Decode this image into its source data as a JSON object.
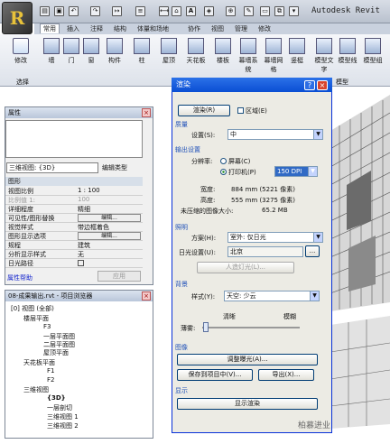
{
  "app": {
    "logo": "R",
    "title": "Autodesk Revit"
  },
  "ribbon": {
    "tabs": [
      "常用",
      "插入",
      "注释",
      "结构",
      "体量和场地",
      "协作",
      "视图",
      "管理",
      "修改"
    ],
    "buttons": [
      "墙",
      "门",
      "窗",
      "构件",
      "柱",
      "屋顶",
      "天花板",
      "楼板",
      "幕墙系统",
      "幕墙网格",
      "竖梃",
      "模型文字",
      "模型线",
      "模型组"
    ],
    "modify": "修改",
    "panel_select": "选择",
    "panel_model": "模型"
  },
  "properties": {
    "title": "属性",
    "type_value": "三维视图: {3D}",
    "edit_type": "编辑类型",
    "section": "图形",
    "rows": [
      {
        "key": "视图比例",
        "value": "1 : 100"
      },
      {
        "key": "比例值 1:",
        "value": "100"
      },
      {
        "key": "详细程度",
        "value": "精细"
      },
      {
        "key": "可见性/图形替换",
        "value": "编辑..."
      },
      {
        "key": "视觉样式",
        "value": "带边框着色"
      },
      {
        "key": "图形显示选项",
        "value": "编辑..."
      },
      {
        "key": "规程",
        "value": "建筑"
      },
      {
        "key": "分析显示样式",
        "value": "无"
      },
      {
        "key": "日光路径",
        "value": ""
      }
    ],
    "help": "属性帮助",
    "apply": "应用"
  },
  "browser": {
    "title": "08-成果输出.rvt - 项目浏览器",
    "nodes": [
      "[0] 视图 (全部)",
      "楼层平面",
      "F3",
      "一层平面图",
      "二层平面图",
      "屋顶平面",
      "天花板平面",
      "F1",
      "F2",
      "三维视图",
      "{3D}",
      "一层剖切",
      "三维视图 1",
      "三维视图 2"
    ]
  },
  "dialog": {
    "title": "渲染",
    "render_btn": "渲染(R)",
    "region": "区域(E)",
    "quality": {
      "label": "质量",
      "setting_label": "设置(S):",
      "value": "中"
    },
    "output": {
      "label": "输出设置",
      "resolution_label": "分辨率:",
      "screen": "屏幕(C)",
      "printer": "打印机(P)",
      "dpi": "150 DPI",
      "width_label": "宽度:",
      "width": "884 mm (5221 像素)",
      "height_label": "高度:",
      "height": "555 mm (3275 像素)",
      "size_label": "未压缩的图像大小:",
      "size": "65.2 MB"
    },
    "lighting": {
      "label": "照明",
      "scheme_label": "方案(H):",
      "scheme": "室外: 仅日光",
      "sun_label": "日光设置(U):",
      "sun": "北京",
      "artificial": "人造灯光(L)..."
    },
    "background": {
      "label": "背景",
      "style_label": "样式(Y):",
      "style": "天空: 少云",
      "clear": "清晰",
      "hazy": "模糊",
      "haze_label": "薄雾:",
      "haze_level": 0.02
    },
    "image": {
      "label": "图像",
      "adjust": "调整曝光(A)...",
      "save": "保存到项目中(V)...",
      "export": "导出(X)..."
    },
    "display": {
      "label": "显示",
      "show": "显示渲染"
    }
  },
  "watermark": "柏慕进业",
  "colors": {
    "title_bar": "#0a4ed3",
    "close": "#d8432c"
  }
}
